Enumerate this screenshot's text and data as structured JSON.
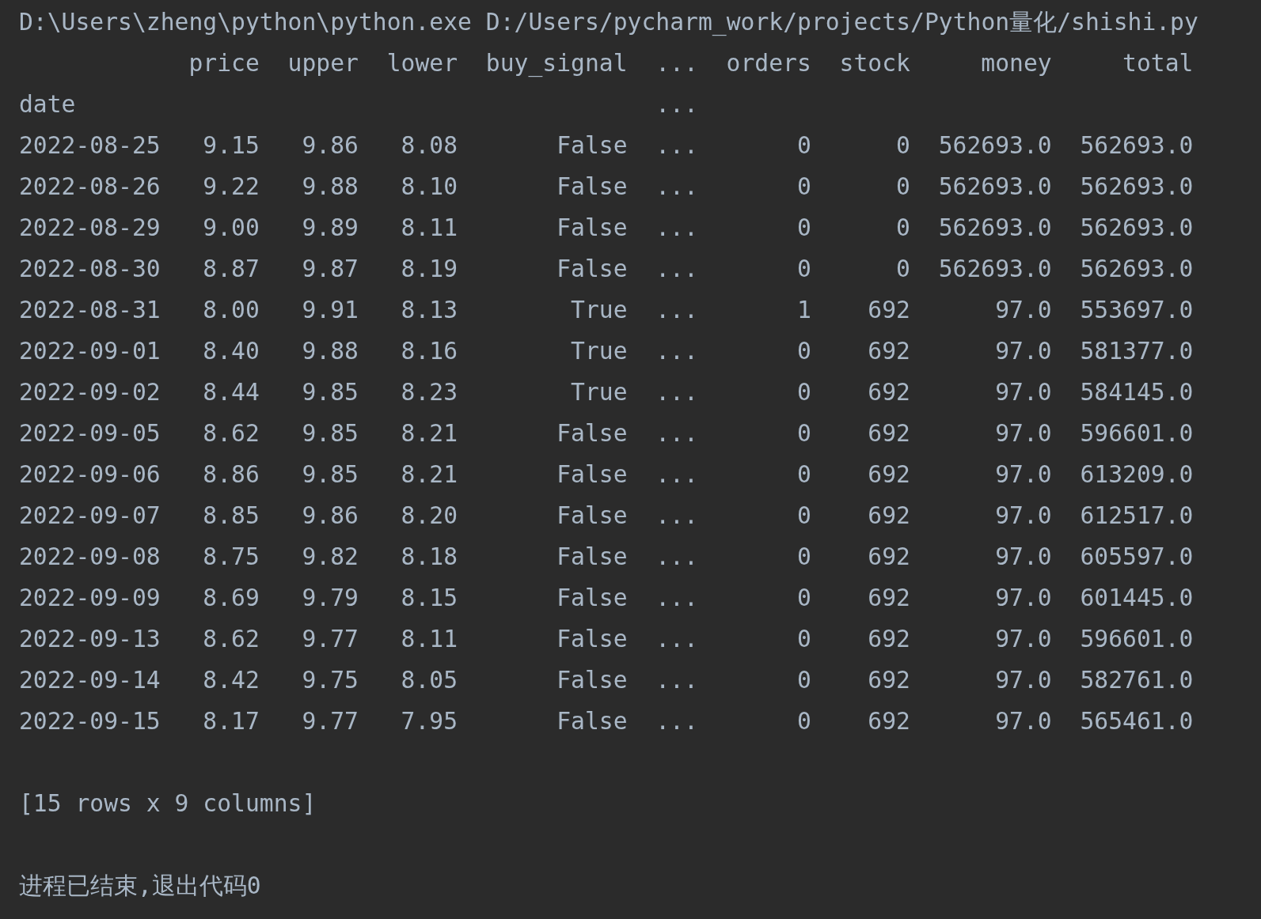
{
  "command": "D:\\Users\\zheng\\python\\python.exe D:/Users/pycharm_work/projects/Python量化/shishi.py",
  "columns": [
    "price",
    "upper",
    "lower",
    "buy_signal",
    "...",
    "orders",
    "stock",
    "money",
    "total"
  ],
  "index_name": "date",
  "index_row_cells": [
    "",
    "",
    "",
    "",
    "...",
    "",
    "",
    "",
    ""
  ],
  "rows": [
    {
      "date": "2022-08-25",
      "cells": [
        "9.15",
        "9.86",
        "8.08",
        "False",
        "...",
        "0",
        "0",
        "562693.0",
        "562693.0"
      ]
    },
    {
      "date": "2022-08-26",
      "cells": [
        "9.22",
        "9.88",
        "8.10",
        "False",
        "...",
        "0",
        "0",
        "562693.0",
        "562693.0"
      ]
    },
    {
      "date": "2022-08-29",
      "cells": [
        "9.00",
        "9.89",
        "8.11",
        "False",
        "...",
        "0",
        "0",
        "562693.0",
        "562693.0"
      ]
    },
    {
      "date": "2022-08-30",
      "cells": [
        "8.87",
        "9.87",
        "8.19",
        "False",
        "...",
        "0",
        "0",
        "562693.0",
        "562693.0"
      ]
    },
    {
      "date": "2022-08-31",
      "cells": [
        "8.00",
        "9.91",
        "8.13",
        "True",
        "...",
        "1",
        "692",
        "97.0",
        "553697.0"
      ]
    },
    {
      "date": "2022-09-01",
      "cells": [
        "8.40",
        "9.88",
        "8.16",
        "True",
        "...",
        "0",
        "692",
        "97.0",
        "581377.0"
      ]
    },
    {
      "date": "2022-09-02",
      "cells": [
        "8.44",
        "9.85",
        "8.23",
        "True",
        "...",
        "0",
        "692",
        "97.0",
        "584145.0"
      ]
    },
    {
      "date": "2022-09-05",
      "cells": [
        "8.62",
        "9.85",
        "8.21",
        "False",
        "...",
        "0",
        "692",
        "97.0",
        "596601.0"
      ]
    },
    {
      "date": "2022-09-06",
      "cells": [
        "8.86",
        "9.85",
        "8.21",
        "False",
        "...",
        "0",
        "692",
        "97.0",
        "613209.0"
      ]
    },
    {
      "date": "2022-09-07",
      "cells": [
        "8.85",
        "9.86",
        "8.20",
        "False",
        "...",
        "0",
        "692",
        "97.0",
        "612517.0"
      ]
    },
    {
      "date": "2022-09-08",
      "cells": [
        "8.75",
        "9.82",
        "8.18",
        "False",
        "...",
        "0",
        "692",
        "97.0",
        "605597.0"
      ]
    },
    {
      "date": "2022-09-09",
      "cells": [
        "8.69",
        "9.79",
        "8.15",
        "False",
        "...",
        "0",
        "692",
        "97.0",
        "601445.0"
      ]
    },
    {
      "date": "2022-09-13",
      "cells": [
        "8.62",
        "9.77",
        "8.11",
        "False",
        "...",
        "0",
        "692",
        "97.0",
        "596601.0"
      ]
    },
    {
      "date": "2022-09-14",
      "cells": [
        "8.42",
        "9.75",
        "8.05",
        "False",
        "...",
        "0",
        "692",
        "97.0",
        "582761.0"
      ]
    },
    {
      "date": "2022-09-15",
      "cells": [
        "8.17",
        "9.77",
        "7.95",
        "False",
        "...",
        "0",
        "692",
        "97.0",
        "565461.0"
      ]
    }
  ],
  "summary": "[15 rows x 9 columns]",
  "exit_message": "进程已结束,退出代码0"
}
